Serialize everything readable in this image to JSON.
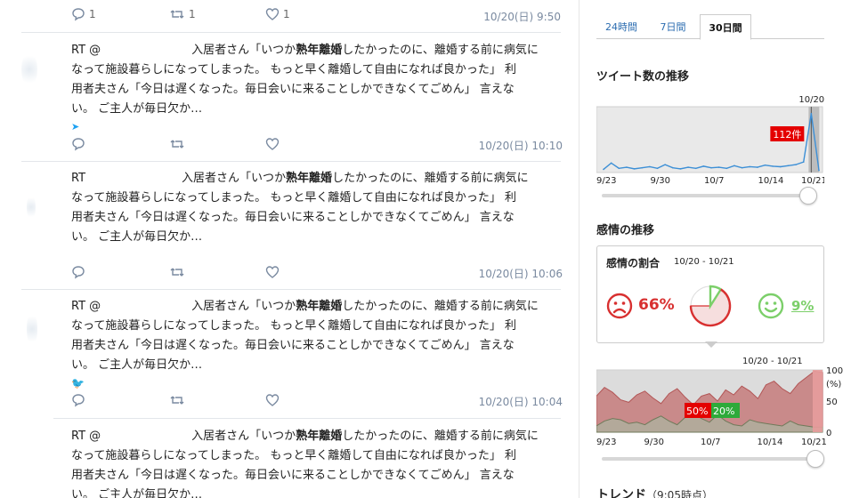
{
  "feed": {
    "top_row": {
      "reply_count": "1",
      "retweet_count": "1",
      "like_count": "1",
      "timestamp": "10/20(日) 9:50"
    },
    "tweets": [
      {
        "rt_prefix": "RT @",
        "line1_a": "入居者さん「いつか",
        "line1_bold": "熟年離婚",
        "line1_b": "したかったのに、離婚する前に病気に",
        "line2": "なって施設暮らしになってしまった。 もっと早く離婚して自由になれば良かった」 利",
        "line3": "用者夫さん「今日は遅くなった。毎日会いに来ることしかできなくてごめん」 言えな",
        "line4": "い。 ご主人が毎日欠か…",
        "timestamp": "10/20(日) 10:10"
      },
      {
        "rt_prefix": "RT",
        "line1_a": "入居者さん「いつか",
        "line1_bold": "熟年離婚",
        "line1_b": "したかったのに、離婚する前に病気に",
        "line2": "なって施設暮らしになってしまった。 もっと早く離婚して自由になれば良かった」 利",
        "line3": "用者夫さん「今日は遅くなった。毎日会いに来ることしかできなくてごめん」 言えな",
        "line4": "い。 ご主人が毎日欠か…",
        "timestamp": "10/20(日) 10:06"
      },
      {
        "rt_prefix": "RT @",
        "line1_a": "入居者さん「いつか",
        "line1_bold": "熟年離婚",
        "line1_b": "したかったのに、離婚する前に病気に",
        "line2": "なって施設暮らしになってしまった。 もっと早く離婚して自由になれば良かった」 利",
        "line3": "用者夫さん「今日は遅くなった。毎日会いに来ることしかできなくてごめん」 言えな",
        "line4": "い。 ご主人が毎日欠か…",
        "timestamp": "10/20(日) 10:04"
      },
      {
        "rt_prefix": "RT @",
        "line1_a": "入居者さん「いつか",
        "line1_bold": "熟年離婚",
        "line1_b": "したかったのに、離婚する前に病気に",
        "line2": "なって施設暮らしになってしまった。 もっと早く離婚して自由になれば良かった」 利",
        "line3": "用者夫さん「今日は遅くなった。毎日会いに来ることしかできなくてごめん」 言えな",
        "line4": "い。 ご主人が毎日欠か…",
        "timestamp": ""
      }
    ]
  },
  "panel": {
    "tabs": [
      "24時間",
      "7日間",
      "30日間"
    ],
    "active_tab": "30日間",
    "tweet_count_title": "ツイート数の推移",
    "sentiment_title": "感情の推移",
    "sentiment_card_title": "感情の割合",
    "sentiment_card_range": "10/20 - 10/21",
    "negative_pct": "66%",
    "positive_pct": "9%",
    "negative_share": 0.66,
    "positive_share": 0.09,
    "trend_title": "トレンド",
    "trend_time": "（9:05時点）",
    "colors": {
      "negative": "#d83030",
      "positive": "#7ccf6a",
      "volume": "#3c8fd6",
      "accent": "#e40000"
    }
  },
  "chart_data": [
    {
      "type": "line",
      "name": "ツイート数の推移",
      "x": [
        "9/23",
        "9/24",
        "9/25",
        "9/26",
        "9/27",
        "9/28",
        "9/29",
        "9/30",
        "10/1",
        "10/2",
        "10/3",
        "10/4",
        "10/5",
        "10/6",
        "10/7",
        "10/8",
        "10/9",
        "10/10",
        "10/11",
        "10/12",
        "10/13",
        "10/14",
        "10/15",
        "10/16",
        "10/17",
        "10/18",
        "10/19",
        "10/20",
        "10/21"
      ],
      "values": [
        6,
        18,
        8,
        10,
        7,
        9,
        11,
        8,
        15,
        9,
        7,
        10,
        8,
        12,
        9,
        10,
        8,
        13,
        9,
        11,
        10,
        14,
        12,
        11,
        13,
        15,
        20,
        112,
        4
      ],
      "x_ticks": [
        "9/23",
        "9/30",
        "10/7",
        "10/14",
        "10/21"
      ],
      "highlight_label": "10/20",
      "highlight_value_label": "112件",
      "ylim": [
        0,
        125
      ]
    },
    {
      "type": "area",
      "name": "感情の推移",
      "x_ticks": [
        "9/23",
        "9/30",
        "10/7",
        "10/14",
        "10/21"
      ],
      "range_label": "10/20 - 10/21",
      "ylabel": "(%)",
      "y_ticks": [
        "100",
        "50",
        "0"
      ],
      "ylim": [
        0,
        100
      ],
      "series": [
        {
          "name": "negative",
          "values": [
            58,
            72,
            64,
            52,
            48,
            60,
            66,
            55,
            46,
            62,
            70,
            56,
            44,
            58,
            62,
            50,
            68,
            60,
            74,
            66,
            54,
            76,
            82,
            70,
            62,
            78,
            88,
            98,
            96
          ]
        },
        {
          "name": "positive",
          "values": [
            10,
            18,
            22,
            20,
            14,
            16,
            12,
            20,
            26,
            18,
            12,
            24,
            30,
            22,
            16,
            28,
            18,
            12,
            10,
            20,
            16,
            14,
            12,
            10,
            18,
            12,
            10,
            8,
            8
          ]
        }
      ],
      "highlight_labels": [
        "50%",
        "20%"
      ]
    }
  ]
}
